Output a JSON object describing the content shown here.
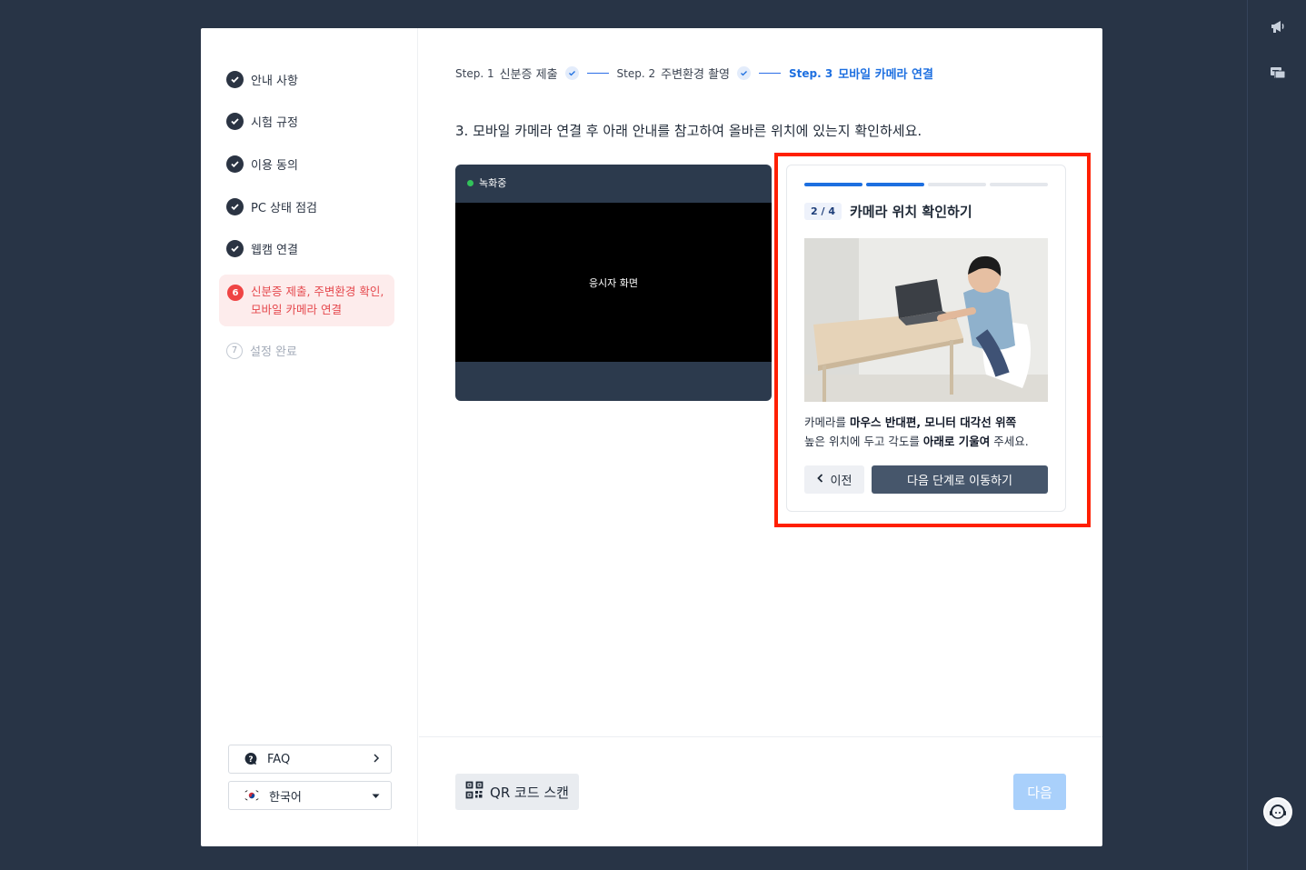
{
  "sidebar": {
    "steps": [
      {
        "label": "안내 사항",
        "state": "done",
        "icon": "check-icon"
      },
      {
        "label": "시험 규정",
        "state": "done",
        "icon": "check-icon"
      },
      {
        "label": "이용 동의",
        "state": "done",
        "icon": "check-icon"
      },
      {
        "label": "PC 상태 점검",
        "state": "done",
        "icon": "check-icon"
      },
      {
        "label": "웹캠 연결",
        "state": "done",
        "icon": "check-icon"
      }
    ],
    "active_step": {
      "number": "6",
      "label": "신분증 제출, 주변환경 확인, 모바일 카메라 연결"
    },
    "pending_step": {
      "number": "7",
      "label": "설정 완료"
    },
    "faq_label": "FAQ",
    "language_label": "한국어"
  },
  "stepper": {
    "step1_prefix": "Step. 1",
    "step1_name": "신분증 제출",
    "step2_prefix": "Step. 2",
    "step2_name": "주변환경 촬영",
    "step3_prefix": "Step. 3",
    "step3_name": "모바일 카메라 연결"
  },
  "instruction": "3. 모바일 카메라 연결 후 아래 안내를 참고하여 올바른 위치에 있는지 확인하세요.",
  "camera": {
    "status_label": "녹화중",
    "screen_label": "응시자 화면"
  },
  "guide": {
    "progress_current": 2,
    "progress_total": 4,
    "badge": "2 / 4",
    "title": "카메라 위치 확인하기",
    "desc_line1_a": "카메라를 ",
    "desc_line1_b": "마우스 반대편, 모니터 대각선 위쪽",
    "desc_line2_a": "높은 위치에 두고 각도를 ",
    "desc_line2_b": "아래로 기울여",
    "desc_line2_c": " 주세요.",
    "prev_label": "이전",
    "next_label": "다음 단계로 이동하기"
  },
  "footer": {
    "qr_label": "QR 코드 스캔",
    "next_label": "다음"
  },
  "colors": {
    "accent": "#1d6fe0",
    "active_step": "#e5484d",
    "highlight_box": "#ff1f00",
    "background": "#283446"
  }
}
